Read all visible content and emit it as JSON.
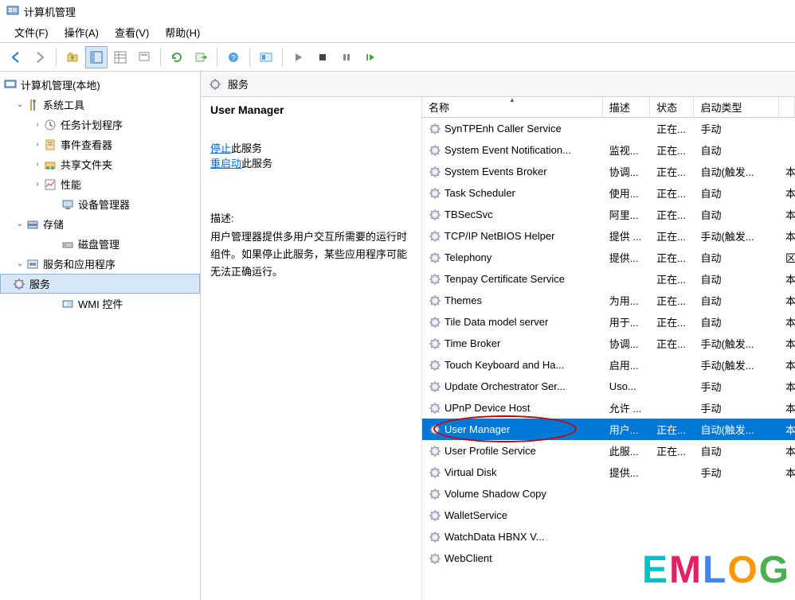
{
  "window": {
    "title": "计算机管理"
  },
  "menubar": {
    "file": "文件(F)",
    "action": "操作(A)",
    "view": "查看(V)",
    "help": "帮助(H)"
  },
  "tree": {
    "root": "计算机管理(本地)",
    "system_tools": "系统工具",
    "task_scheduler": "任务计划程序",
    "event_viewer": "事件查看器",
    "shared_folders": "共享文件夹",
    "performance": "性能",
    "device_manager": "设备管理器",
    "storage": "存储",
    "disk_mgmt": "磁盘管理",
    "services_apps": "服务和应用程序",
    "services": "服务",
    "wmi": "WMI 控件"
  },
  "right": {
    "header": "服务",
    "selected_service": "User Manager",
    "stop_prefix": "停止",
    "stop_suffix": "此服务",
    "restart_prefix": "重启动",
    "restart_suffix": "此服务",
    "desc_label": "描述:",
    "desc_text": "用户管理器提供多用户交互所需要的运行时组件。如果停止此服务，某些应用程序可能无法正确运行。"
  },
  "columns": {
    "name": "名称",
    "desc": "描述",
    "status": "状态",
    "startup": "启动类型"
  },
  "services": [
    {
      "name": "SynTPEnh Caller Service",
      "desc": "",
      "status": "正在...",
      "startup": "手动",
      "last": ""
    },
    {
      "name": "System Event Notification...",
      "desc": "监视...",
      "status": "正在...",
      "startup": "自动",
      "last": ""
    },
    {
      "name": "System Events Broker",
      "desc": "协调...",
      "status": "正在...",
      "startup": "自动(触发...",
      "last": "本"
    },
    {
      "name": "Task Scheduler",
      "desc": "使用...",
      "status": "正在...",
      "startup": "自动",
      "last": "本"
    },
    {
      "name": "TBSecSvc",
      "desc": "阿里...",
      "status": "正在...",
      "startup": "自动",
      "last": "本"
    },
    {
      "name": "TCP/IP NetBIOS Helper",
      "desc": "提供 ...",
      "status": "正在...",
      "startup": "手动(触发...",
      "last": "本"
    },
    {
      "name": "Telephony",
      "desc": "提供...",
      "status": "正在...",
      "startup": "自动",
      "last": "区"
    },
    {
      "name": "Tenpay Certificate Service",
      "desc": "",
      "status": "正在...",
      "startup": "自动",
      "last": "本"
    },
    {
      "name": "Themes",
      "desc": "为用...",
      "status": "正在...",
      "startup": "自动",
      "last": "本"
    },
    {
      "name": "Tile Data model server",
      "desc": "用于...",
      "status": "正在...",
      "startup": "自动",
      "last": "本"
    },
    {
      "name": "Time Broker",
      "desc": "协调...",
      "status": "正在...",
      "startup": "手动(触发...",
      "last": "本"
    },
    {
      "name": "Touch Keyboard and Ha...",
      "desc": "启用...",
      "status": "",
      "startup": "手动(触发...",
      "last": "本"
    },
    {
      "name": "Update Orchestrator Ser...",
      "desc": "Uso...",
      "status": "",
      "startup": "手动",
      "last": "本"
    },
    {
      "name": "UPnP Device Host",
      "desc": "允许 ...",
      "status": "",
      "startup": "手动",
      "last": "本"
    },
    {
      "name": "User Manager",
      "desc": "用户...",
      "status": "正在...",
      "startup": "自动(触发...",
      "last": "本",
      "selected": true
    },
    {
      "name": "User Profile Service",
      "desc": "此服...",
      "status": "正在...",
      "startup": "自动",
      "last": "本"
    },
    {
      "name": "Virtual Disk",
      "desc": "提供...",
      "status": "",
      "startup": "手动",
      "last": "本"
    },
    {
      "name": "Volume Shadow Copy",
      "desc": "",
      "status": "",
      "startup": "",
      "last": ""
    },
    {
      "name": "WalletService",
      "desc": "",
      "status": "",
      "startup": "",
      "last": ""
    },
    {
      "name": "WatchData HBNX V...",
      "desc": "",
      "status": "",
      "startup": "",
      "last": ""
    },
    {
      "name": "WebClient",
      "desc": "",
      "status": "",
      "startup": "",
      "last": ""
    }
  ],
  "watermark": "EMLOG"
}
